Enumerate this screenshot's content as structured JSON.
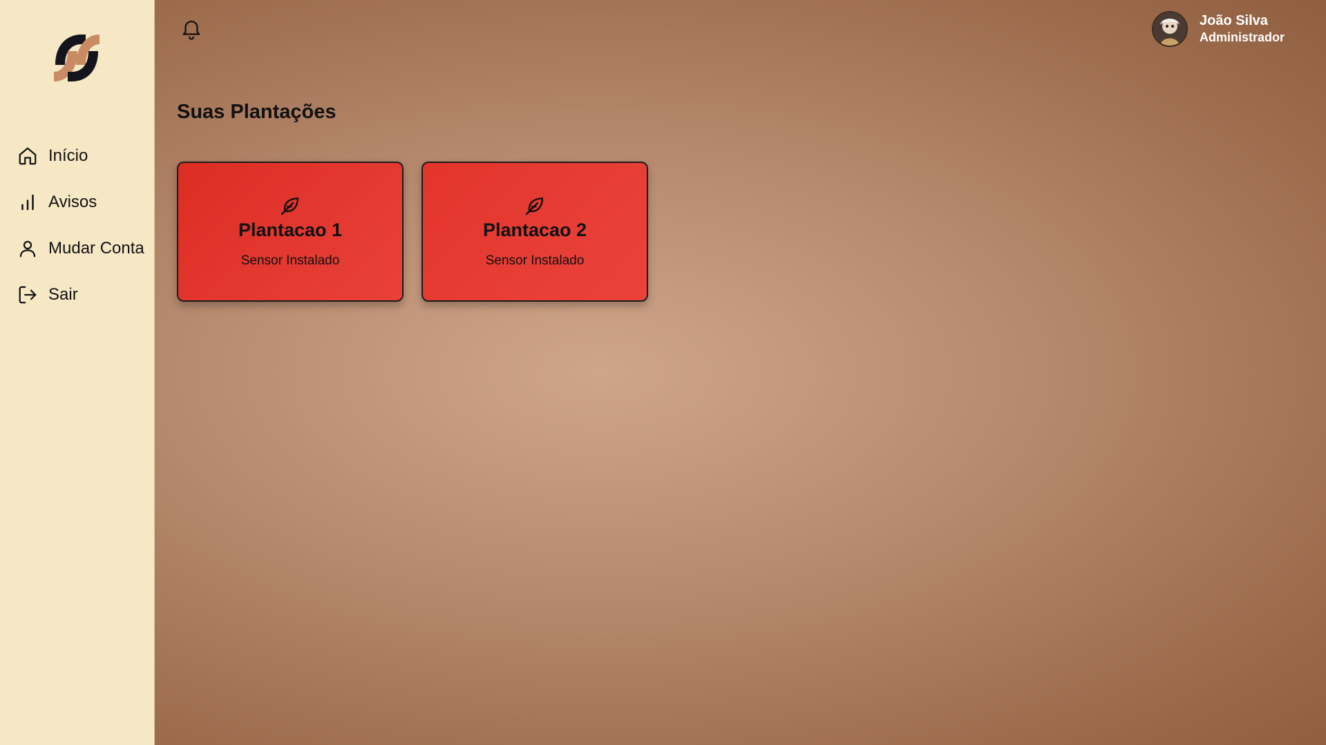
{
  "sidebar": {
    "items": [
      {
        "label": "Início",
        "icon": "home-icon"
      },
      {
        "label": "Avisos",
        "icon": "bar-chart-icon"
      },
      {
        "label": "Mudar Conta",
        "icon": "user-icon"
      },
      {
        "label": "Sair",
        "icon": "logout-icon"
      }
    ]
  },
  "header": {
    "user": {
      "name": "João Silva",
      "role": "Administrador"
    }
  },
  "main": {
    "title": "Suas Plantações",
    "cards": [
      {
        "title": "Plantacao 1",
        "subtitle": "Sensor Instalado",
        "icon": "leaf-icon"
      },
      {
        "title": "Plantacao 2",
        "subtitle": "Sensor Instalado",
        "icon": "leaf-icon"
      }
    ]
  },
  "colors": {
    "sidebar_bg": "#f6e8c5",
    "card_red": "#e2352c",
    "logo_dark": "#14141e",
    "logo_light": "#c98b63"
  }
}
